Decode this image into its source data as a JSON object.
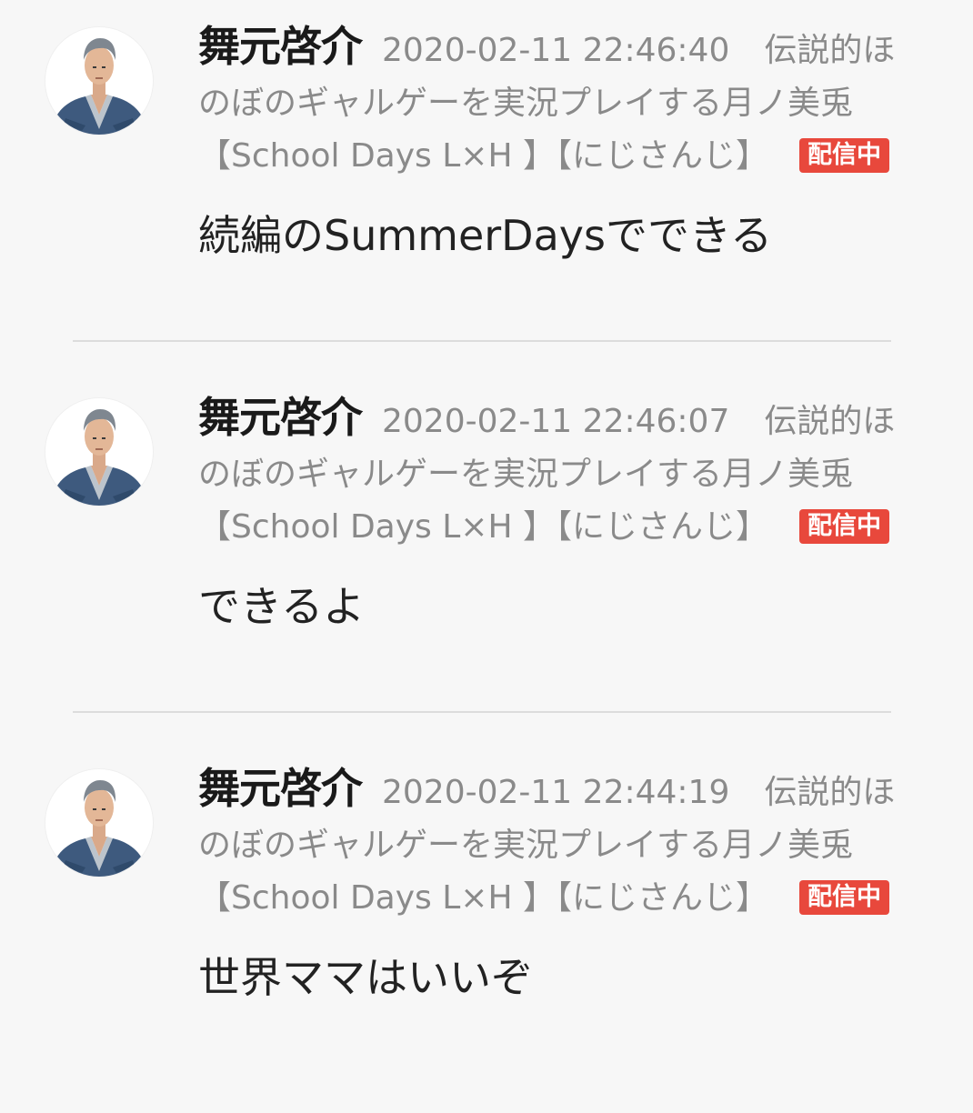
{
  "comments": [
    {
      "username": "舞元啓介",
      "timestamp": "2020-02-11 22:46:40",
      "stream_title": "伝説的ほのぼのギャルゲーを実況プレイする月ノ美兎【School Days L×H 】【にじさんじ】",
      "live_badge": "配信中",
      "message": "続編のSummerDaysでできる"
    },
    {
      "username": "舞元啓介",
      "timestamp": "2020-02-11 22:46:07",
      "stream_title": "伝説的ほのぼのギャルゲーを実況プレイする月ノ美兎【School Days L×H 】【にじさんじ】",
      "live_badge": "配信中",
      "message": "できるよ"
    },
    {
      "username": "舞元啓介",
      "timestamp": "2020-02-11 22:44:19",
      "stream_title": "伝説的ほのぼのギャルゲーを実況プレイする月ノ美兎【School Days L×H 】【にじさんじ】",
      "live_badge": "配信中",
      "message": "世界ママはいいぞ"
    }
  ],
  "colors": {
    "background": "#f7f7f7",
    "live_badge": "#e8483c",
    "meta_text": "#8a8a8a",
    "username_text": "#1a1a1a",
    "divider": "#dcdcdc"
  },
  "icons": {
    "avatar": "avatar-icon"
  }
}
